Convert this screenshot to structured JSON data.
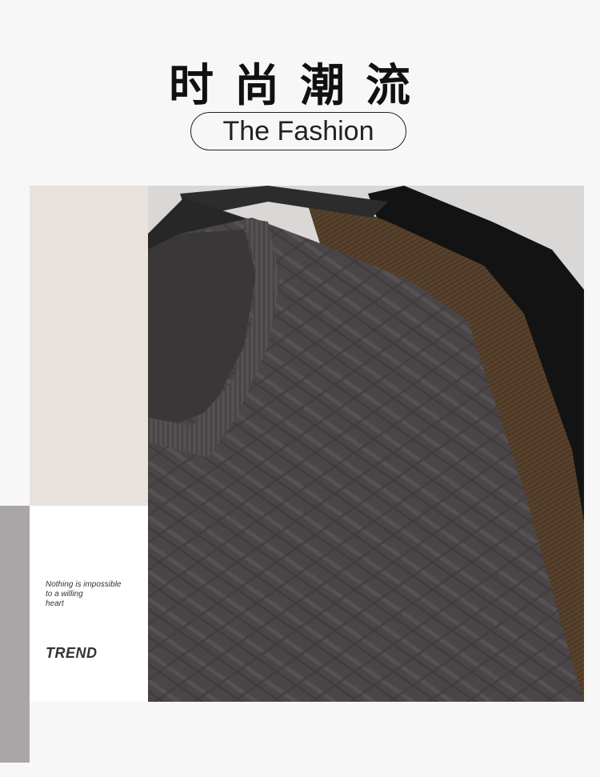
{
  "header": {
    "title_cn": "时尚潮流",
    "subtitle_en": "The Fashion"
  },
  "side_panel": {
    "quote_lines": [
      "Nothing is impossible",
      "to a willing",
      "heart"
    ],
    "tag": "TREND"
  },
  "photo": {
    "subject": "sweaters-on-hangers",
    "colors": {
      "charcoal_sweater": "#4f4a4b",
      "brown_sweater": "#5e4630",
      "black_sweater": "#151515",
      "hanger": "#2a2a2a"
    }
  },
  "colors": {
    "background": "#f7f7f7",
    "beige_block": "#e9e2dd",
    "gray_bar": "#aaa6a7",
    "white_block": "#ffffff",
    "text_dark": "#111111"
  }
}
